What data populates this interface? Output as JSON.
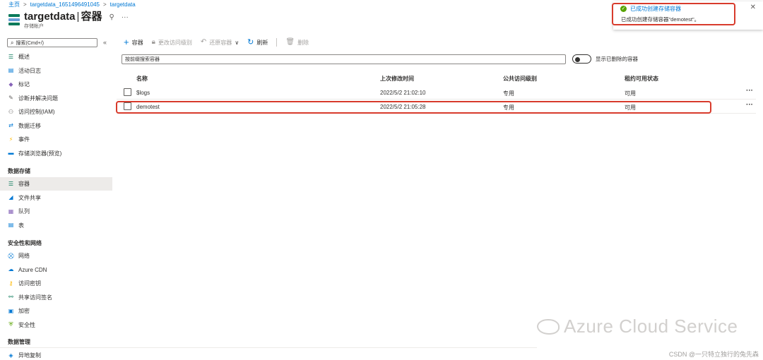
{
  "breadcrumb": {
    "items": [
      "主页",
      "targetdata_1651496491045",
      "targetdata"
    ],
    "separator": ">"
  },
  "header": {
    "title": "targetdata",
    "divider": "|",
    "section": "容器",
    "subtitle": "存储帐户",
    "pin": "⚲",
    "more": "···"
  },
  "sidebar": {
    "search_placeholder": "搜索(Cmd+/)",
    "collapse": "«",
    "items": [
      {
        "label": "概述",
        "icon": "overview-icon",
        "color": "#0a7a5a"
      },
      {
        "label": "活动日志",
        "icon": "activity-log-icon",
        "color": "#0078d4"
      },
      {
        "label": "标记",
        "icon": "tag-icon",
        "color": "#8764b8"
      },
      {
        "label": "诊断并解决问题",
        "icon": "wrench-icon",
        "color": "#605e5c"
      },
      {
        "label": "访问控制(IAM)",
        "icon": "iam-icon",
        "color": "#605e5c"
      },
      {
        "label": "数据迁移",
        "icon": "data-migration-icon",
        "color": "#0078d4"
      },
      {
        "label": "事件",
        "icon": "lightning-icon",
        "color": "#ffb900"
      },
      {
        "label": "存储浏览器(预览)",
        "icon": "folder-icon",
        "color": "#0078d4"
      }
    ],
    "group_data_storage": "数据存储",
    "data_storage_items": [
      {
        "label": "容器",
        "icon": "container-icon",
        "color": "#0a7a5a",
        "active": true
      },
      {
        "label": "文件共享",
        "icon": "file-share-icon",
        "color": "#0078d4"
      },
      {
        "label": "队列",
        "icon": "queue-icon",
        "color": "#8764b8"
      },
      {
        "label": "表",
        "icon": "table-icon",
        "color": "#0078d4"
      }
    ],
    "group_security": "安全性和网络",
    "security_items": [
      {
        "label": "网络",
        "icon": "network-icon",
        "color": "#0078d4"
      },
      {
        "label": "Azure CDN",
        "icon": "cdn-cloud-icon",
        "color": "#0078d4"
      },
      {
        "label": "访问密钥",
        "icon": "key-icon",
        "color": "#ffb900"
      },
      {
        "label": "共享访问签名",
        "icon": "link-icon",
        "color": "#0a7a5a"
      },
      {
        "label": "加密",
        "icon": "lock-icon",
        "color": "#0078d4"
      },
      {
        "label": "安全性",
        "icon": "shield-icon",
        "color": "#57a300"
      }
    ],
    "group_data_management": "数据管理",
    "data_management_items": [
      {
        "label": "异地复制",
        "icon": "geo-replication-icon",
        "color": "#0078d4"
      }
    ]
  },
  "toolbar": {
    "add_icon": "+",
    "add": "容器",
    "change_access": "更改访问级别",
    "restore": "还原容器",
    "restore_chevron": "∨",
    "refresh": "刷新",
    "delete": "删除"
  },
  "filter": {
    "placeholder": "按前缀搜索容器",
    "toggle_label": "显示已删除的容器"
  },
  "table": {
    "headers": [
      "名称",
      "上次修改时间",
      "公共访问级别",
      "租约可用状态"
    ],
    "rows": [
      {
        "name": "$logs",
        "modified": "2022/5/2 21:02:10",
        "access": "专用",
        "lease": "可用",
        "more": "···"
      },
      {
        "name": "demotest",
        "modified": "2022/5/2 21:05:28",
        "access": "专用",
        "lease": "可用",
        "more": "···"
      }
    ]
  },
  "notification": {
    "title": "已成功创建存储容器",
    "body": "已成功创建存储容器\"demotest\"。",
    "close": "✕"
  },
  "watermark": {
    "text": "Azure Cloud Service",
    "csdn": "CSDN @一只特立独行的兔先森"
  },
  "colors": {
    "accent": "#0078d4",
    "highlight": "#d83b2c",
    "success": "#57a300"
  }
}
